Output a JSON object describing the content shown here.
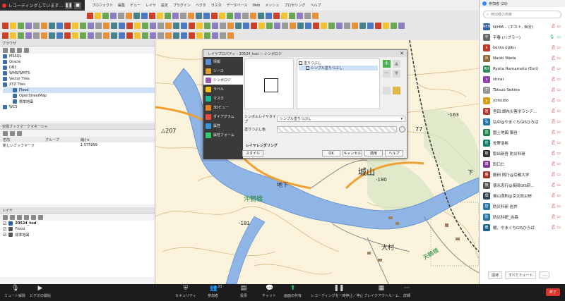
{
  "recording": {
    "label": "レコーディングしています...",
    "pause": "❚❚",
    "stop": "■"
  },
  "qgis": {
    "menus": [
      "プロジェクト",
      "編集",
      "ビュー",
      "レイヤ",
      "設定",
      "プラグイン",
      "ベクタ",
      "ラスタ",
      "データベース",
      "Web",
      "メッシュ",
      "プロセシング",
      "ヘルプ"
    ],
    "browser": {
      "title": "ブラウザ",
      "items": [
        "MSSQL",
        "Oracle",
        "DB2",
        "WMS/WMTS",
        "Vector Tiles",
        "XYZ Tiles",
        "Flood",
        "OpenStreetMap",
        "標準地図",
        "WCS"
      ]
    },
    "spatial_bookmarks": {
      "title": "空間ブックマークマネージャ",
      "columns": [
        "名前",
        "グループ",
        "縮小s"
      ],
      "row": {
        "name": "新しいブックマーク",
        "group": "",
        "scale": "1:575999"
      }
    },
    "layers": {
      "title": "レイヤ",
      "items": [
        "20524_hsd",
        "Flood",
        "標準地図"
      ]
    },
    "map_labels": {
      "kusaki_bridge": "沖鶴橋",
      "castle": "城山",
      "elev_180": "-180",
      "elev_181": "-181",
      "elev_163": "-163",
      "elev_77": "77",
      "elev_207": "△207",
      "chika": "地下",
      "omura": "大村",
      "higashi_bridge": "天鶴橋",
      "shimo": "下"
    }
  },
  "dialog": {
    "title": "レイヤプロパティ - 20524_hsd — シンボロジ",
    "nav": [
      "情報",
      "ソース",
      "シンボロジ",
      "ラベル",
      "マスク",
      "3Dビュー",
      "ダイアグラム",
      "属性",
      "属性フォーム"
    ],
    "nav_selected": 2,
    "tree_root": "塗りつぶし",
    "tree_child": "シンプル塗りつぶし",
    "layer_type_label": "シンボルレイヤタイプ",
    "layer_type_value": "シンプル塗りつぶし",
    "fill_color_label": "塗りつぶし色",
    "layer_rendering": "レイヤレンダリング",
    "style_btn": "スタイル",
    "ok": "OK",
    "cancel": "キャンセル",
    "apply": "適用",
    "help": "ヘルプ"
  },
  "zoom": {
    "panel_title": "参加者 (29)",
    "search_placeholder": "参加者の検索",
    "participants": [
      {
        "avatar": "NEN",
        "color": "#2d5fa3",
        "name": "N/HM... (ホスト, 自分)",
        "mic": "off",
        "cam": "off"
      },
      {
        "avatar": "平",
        "color": "#666666",
        "name": "平春 (ハブラー)",
        "mic": "on",
        "cam": "on"
      },
      {
        "avatar": "k",
        "color": "#c0392b",
        "name": "kenta ogiku",
        "mic": "off",
        "cam": "off"
      },
      {
        "avatar": "N",
        "color": "#8e6b3a",
        "name": "Naoki Wada",
        "mic": "off",
        "cam": "off"
      },
      {
        "avatar": "RH",
        "color": "#2e8b57",
        "name": "Ryota Hamamoto (Esri)",
        "mic": "off",
        "cam": "off"
      },
      {
        "avatar": "s",
        "color": "#8e44ad",
        "name": "shirai",
        "mic": "off",
        "cam": "off"
      },
      {
        "avatar": "T",
        "color": "#999999",
        "name": "Tatsuo Sekine",
        "mic": "off",
        "cam": "off"
      },
      {
        "avatar": "y",
        "color": "#d4a017",
        "name": "yotsubo",
        "mic": "off",
        "cam": "off"
      },
      {
        "avatar": "宮",
        "color": "#b03a2e",
        "name": "宮田:調布災害ボランテ...",
        "mic": "off",
        "cam": "off"
      },
      {
        "avatar": "弘",
        "color": "#2471a3",
        "name": "弘中@やまぐちGISひろば",
        "mic": "off",
        "cam": "off"
      },
      {
        "avatar": "国",
        "color": "#1e8449",
        "name": "国土地図 猿谷",
        "mic": "off",
        "cam": "off"
      },
      {
        "avatar": "佐",
        "color": "#117a65",
        "name": "佐野浩彬",
        "mic": "off",
        "cam": "off"
      },
      {
        "avatar": "取",
        "color": "#333333",
        "name": "取出新吾 防災科研",
        "mic": "off",
        "cam": "off"
      },
      {
        "avatar": "田",
        "color": "#7d3c98",
        "name": "田口仁",
        "mic": "off",
        "cam": "off"
      },
      {
        "avatar": "藤",
        "color": "#a93226",
        "name": "藤田 翔乃@京都大学",
        "mic": "off",
        "cam": "off"
      },
      {
        "avatar": "徳",
        "color": "#555555",
        "name": "徳永忠行@長岡GIS研...",
        "mic": "off",
        "cam": "off"
      },
      {
        "avatar": "畑",
        "color": "#2e4053",
        "name": "畑山満則@京大防災研",
        "mic": "off",
        "cam": "off"
      },
      {
        "avatar": "防",
        "color": "#2874a6",
        "name": "防災科研 岩井",
        "mic": "off",
        "cam": "off"
      },
      {
        "avatar": "防",
        "color": "#2874a6",
        "name": "防災科研_吉森",
        "mic": "off",
        "cam": "off"
      },
      {
        "avatar": "暖",
        "color": "#1f618d",
        "name": "暖、やまぐちGISひろば",
        "mic": "off",
        "cam": "off"
      }
    ],
    "invite": "招待",
    "mute_all": "すべてミュート",
    "more": "..."
  },
  "controls": {
    "unmute": "ミュート解除",
    "start_video": "ビデオの開始",
    "security": "セキュリティ",
    "participants": "参加者",
    "participants_count": "20",
    "polls": "投票",
    "chat": "チャット",
    "share": "画面の共有",
    "recording": "レコーディングを一時停止／停止",
    "breakout": "ブレイクアウトルーム",
    "details": "詳細",
    "end": "終了"
  }
}
